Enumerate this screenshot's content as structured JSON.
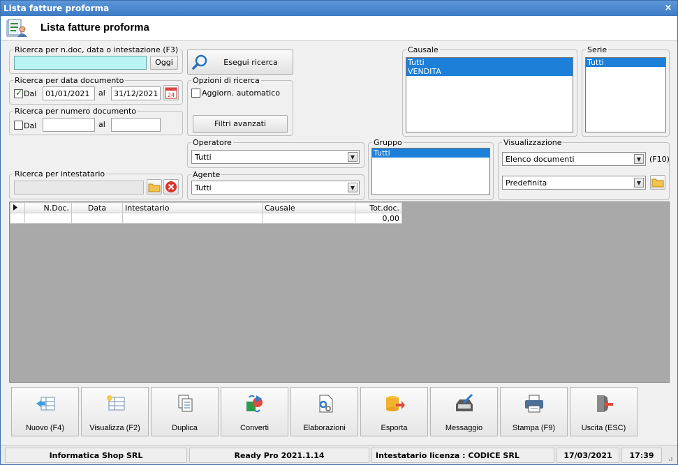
{
  "window": {
    "title": "Lista fatture proforma",
    "close_glyph": "×"
  },
  "header": {
    "title": "Lista fatture proforma",
    "icon": "document-list-icon"
  },
  "search": {
    "legend": "Ricerca per n.doc, data o intestazione (F3)",
    "value": "",
    "today_label": "Oggi",
    "execute_label": "Esegui ricerca"
  },
  "date_search": {
    "legend": "Ricerca per data documento",
    "from_label": "Dal",
    "checked": true,
    "from": "01/01/2021",
    "to_label": "al",
    "to": "31/12/2021",
    "calendar_day": "24"
  },
  "number_search": {
    "legend": "Ricerca per numero documento",
    "from_label": "Dal",
    "checked": false,
    "from": "",
    "to_label": "al",
    "to": ""
  },
  "options": {
    "legend": "Opzioni di ricerca",
    "auto_update_label": "Aggiorn. automatico",
    "auto_update": false,
    "advanced_filters_label": "Filtri avanzati"
  },
  "causale": {
    "legend": "Causale",
    "items": [
      "Tutti",
      "VENDITA"
    ]
  },
  "serie": {
    "legend": "Serie",
    "items": [
      "Tutti"
    ]
  },
  "operatore": {
    "legend": "Operatore",
    "value": "Tutti"
  },
  "agente": {
    "legend": "Agente",
    "value": "Tutti"
  },
  "gruppo": {
    "legend": "Gruppo",
    "items": [
      "Tutti"
    ]
  },
  "visualizzazione": {
    "legend": "Visualizzazione",
    "mode": "Elenco documenti",
    "shortcut": "(F10)",
    "layout": "Predefinita"
  },
  "intestatario": {
    "legend": "Ricerca per intestatario",
    "value": ""
  },
  "grid": {
    "columns": [
      "N.Doc.",
      "Data",
      "Intestatario",
      "Causale",
      "Tot.doc."
    ],
    "rows": [
      [
        "",
        "",
        "",
        "",
        "0,00"
      ]
    ]
  },
  "toolbar": [
    {
      "label": "Nuovo (F4)",
      "icon": "new-document-icon"
    },
    {
      "label": "Visualizza (F2)",
      "icon": "view-document-icon"
    },
    {
      "label": "Duplica",
      "icon": "duplicate-icon"
    },
    {
      "label": "Converti",
      "icon": "convert-icon"
    },
    {
      "label": "Elaborazioni",
      "icon": "process-icon"
    },
    {
      "label": "Esporta",
      "icon": "export-icon"
    },
    {
      "label": "Messaggio",
      "icon": "message-icon"
    },
    {
      "label": "Stampa (F9)",
      "icon": "print-icon"
    },
    {
      "label": "Uscita (ESC)",
      "icon": "exit-icon"
    }
  ],
  "status": {
    "company": "Informatica Shop SRL",
    "version": "Ready Pro 2021.1.14",
    "license": "Intestatario licenza : CODICE SRL",
    "date": "17/03/2021",
    "time": "17:39"
  },
  "colors": {
    "accent": "#1c7fd8",
    "title_bar": "#3d7bc4",
    "search_field": "#b9f4f3",
    "grid_bg": "#a9a9a9"
  }
}
